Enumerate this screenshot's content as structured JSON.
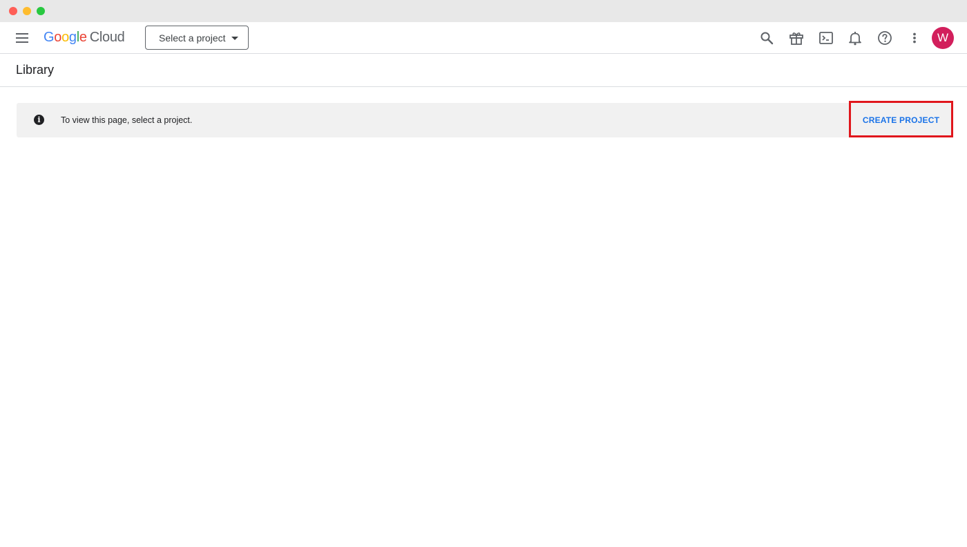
{
  "window": {
    "controls": [
      "close",
      "minimize",
      "maximize"
    ]
  },
  "topbar": {
    "menu_icon": "hamburger-menu-icon",
    "logo": {
      "letters": [
        {
          "char": "G",
          "color": "#4285f4"
        },
        {
          "char": "o",
          "color": "#ea4335"
        },
        {
          "char": "o",
          "color": "#fbbc05"
        },
        {
          "char": "g",
          "color": "#4285f4"
        },
        {
          "char": "l",
          "color": "#34a853"
        },
        {
          "char": "e",
          "color": "#ea4335"
        }
      ],
      "product": "Cloud"
    },
    "project_selector": {
      "label": "Select a project",
      "icon": "caret-down-icon"
    },
    "icons": [
      "search-icon",
      "gift-icon",
      "terminal-icon",
      "bell-icon",
      "help-icon",
      "more-vert-icon"
    ],
    "avatar": {
      "initial": "W",
      "color": "#d21f5c"
    }
  },
  "page": {
    "title": "Library"
  },
  "banner": {
    "icon": "info-icon",
    "message": "To view this page, select a project.",
    "action_label": "CREATE PROJECT",
    "action_color": "#1a73e8",
    "highlight_color": "#e0161c"
  }
}
